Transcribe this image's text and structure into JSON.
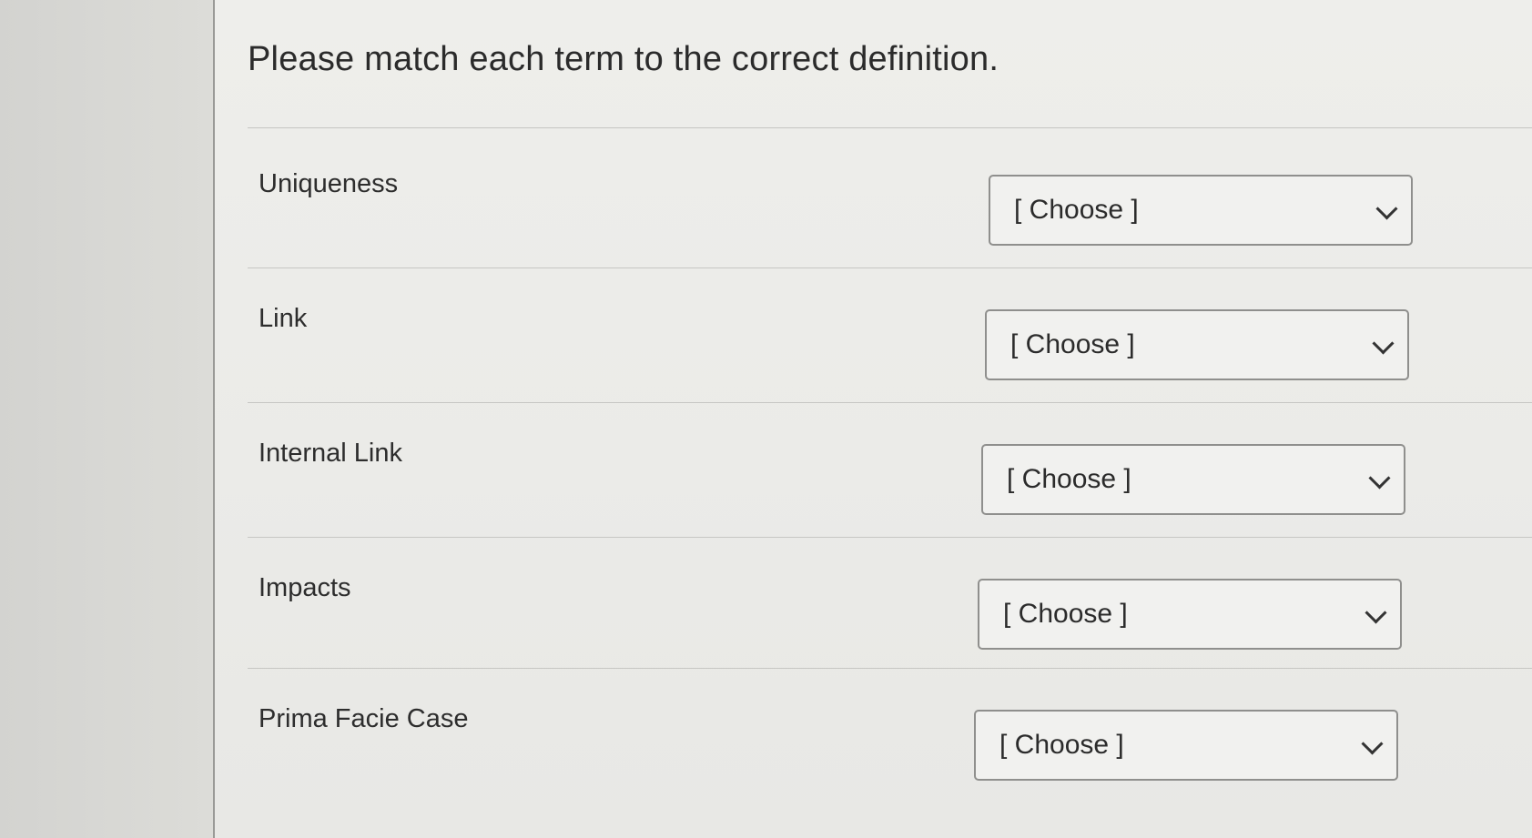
{
  "question": {
    "text": "Please match each term to the correct definition."
  },
  "rows": [
    {
      "term": "Uniqueness",
      "selected": "[ Choose ]"
    },
    {
      "term": "Link",
      "selected": "[ Choose ]"
    },
    {
      "term": "Internal Link",
      "selected": "[ Choose ]"
    },
    {
      "term": "Impacts",
      "selected": "[ Choose ]"
    },
    {
      "term": "Prima Facie Case",
      "selected": "[ Choose ]"
    }
  ],
  "icons": {
    "dropdown": "chevron-down-icon"
  }
}
